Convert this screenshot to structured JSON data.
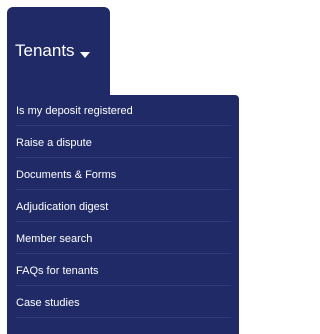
{
  "nav": {
    "tab_label": "Tenants",
    "tab_icon": "caret-down-icon"
  },
  "dropdown": {
    "items": [
      {
        "label": "Is my deposit registered"
      },
      {
        "label": "Raise a dispute"
      },
      {
        "label": "Documents & Forms"
      },
      {
        "label": "Adjudication digest"
      },
      {
        "label": "Member search"
      },
      {
        "label": "FAQs for tenants"
      },
      {
        "label": "Case studies"
      }
    ]
  },
  "colors": {
    "navy": "#1f2a66",
    "text": "#ffffff",
    "divider": "#2d3a7d"
  }
}
